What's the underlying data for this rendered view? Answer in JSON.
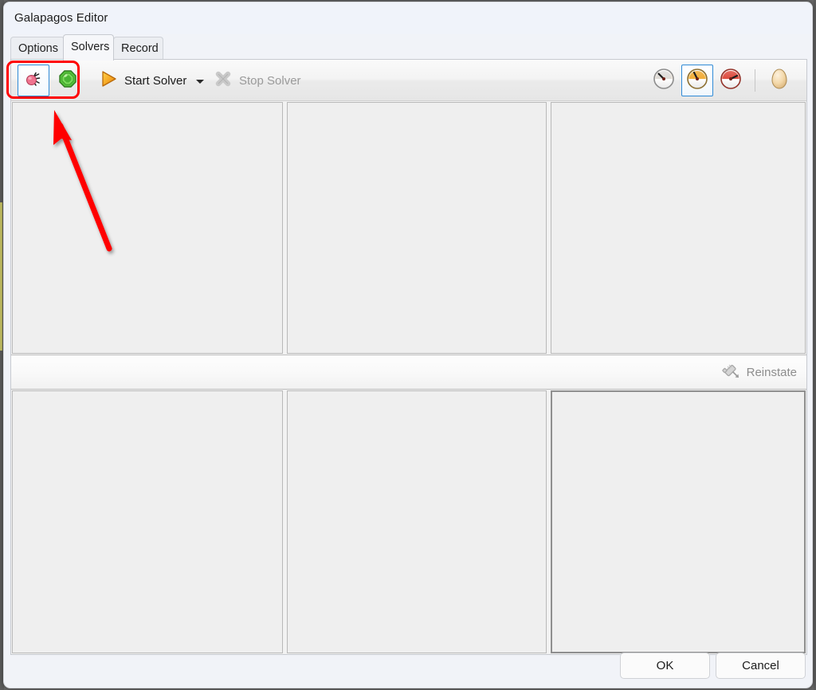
{
  "window": {
    "title": "Galapagos Editor"
  },
  "tabs": [
    {
      "label": "Options",
      "selected": false
    },
    {
      "label": "Solvers",
      "selected": true
    },
    {
      "label": "Record",
      "selected": false
    }
  ],
  "toolbar": {
    "solver_buttons": [
      {
        "name": "simulated-annealing-solver",
        "icon": "bug-icon",
        "checked": true,
        "color": "#e8607f"
      },
      {
        "name": "genetic-solver",
        "icon": "gem-icon",
        "checked": false,
        "color": "#4dc43b"
      }
    ],
    "start_solver_label": "Start Solver",
    "start_solver_enabled": true,
    "stop_solver_label": "Stop Solver",
    "stop_solver_enabled": false,
    "speed_buttons": [
      {
        "name": "speed-slow-button",
        "icon": "gauge-slow-icon",
        "checked": false,
        "dial": "#9b9b9b"
      },
      {
        "name": "speed-medium-button",
        "icon": "gauge-medium-icon",
        "checked": true,
        "dial": "#f0a427"
      },
      {
        "name": "speed-fast-button",
        "icon": "gauge-fast-icon",
        "checked": false,
        "dial": "#d8382b"
      }
    ],
    "egg_button": {
      "name": "egg-button",
      "icon": "egg-icon",
      "checked": false
    }
  },
  "midbar": {
    "reinstate_label": "Reinstate",
    "reinstate_icon": "syringe-icon",
    "reinstate_enabled": false
  },
  "footer": {
    "ok_label": "OK",
    "cancel_label": "Cancel"
  },
  "annotation": {
    "arrow_color": "#ff0000",
    "highlight_color": "#ff0000",
    "arrow_from": "137,312",
    "arrow_to": "68,144",
    "highlight_target": "solver-mode-button-group"
  },
  "accent": {
    "selection_blue": "#2f8ad6",
    "panel_bg": "#efefef",
    "window_bg": "#f1f3f8"
  }
}
